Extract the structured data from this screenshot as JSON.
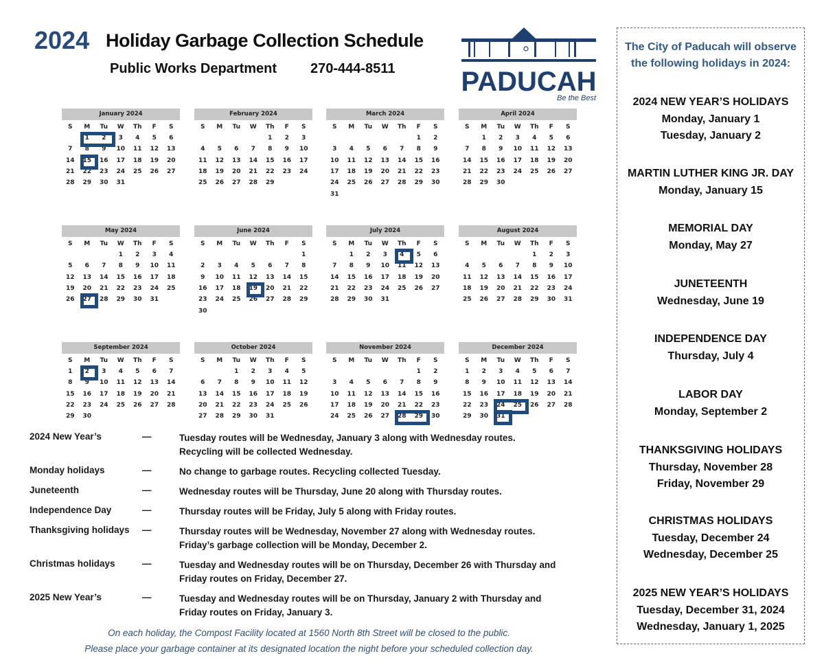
{
  "header": {
    "year": "2024",
    "title": "Holiday Garbage Collection Schedule",
    "department": "Public Works Department",
    "phone": "270-444-8511"
  },
  "logo": {
    "name": "PADUCAH",
    "tagline": "Be the Best",
    "color": "#1f3f6e"
  },
  "weekdays": [
    "S",
    "M",
    "Tu",
    "W",
    "Th",
    "F",
    "S"
  ],
  "accent": "#1f4a7d",
  "months": [
    {
      "title": "January 2024",
      "start": 1,
      "days": 31,
      "highlights": [
        [
          1,
          2
        ],
        [
          15
        ]
      ]
    },
    {
      "title": "February 2024",
      "start": 4,
      "days": 29,
      "highlights": []
    },
    {
      "title": "March 2024",
      "start": 5,
      "days": 31,
      "highlights": []
    },
    {
      "title": "April 2024",
      "start": 1,
      "days": 30,
      "highlights": []
    },
    {
      "title": "May 2024",
      "start": 3,
      "days": 31,
      "highlights": [
        [
          27
        ]
      ]
    },
    {
      "title": "June 2024",
      "start": 6,
      "days": 30,
      "highlights": [
        [
          19
        ]
      ]
    },
    {
      "title": "July 2024",
      "start": 1,
      "days": 31,
      "highlights": [
        [
          4
        ]
      ]
    },
    {
      "title": "August 2024",
      "start": 4,
      "days": 31,
      "highlights": []
    },
    {
      "title": "September 2024",
      "start": 0,
      "days": 30,
      "highlights": [
        [
          2
        ]
      ]
    },
    {
      "title": "October 2024",
      "start": 2,
      "days": 31,
      "highlights": []
    },
    {
      "title": "November 2024",
      "start": 5,
      "days": 30,
      "highlights": [
        [
          28,
          29
        ]
      ]
    },
    {
      "title": "December 2024",
      "start": 0,
      "days": 31,
      "highlights": [
        [
          24,
          25
        ],
        [
          31
        ]
      ]
    }
  ],
  "notes": [
    {
      "label": "2024 New Year’s",
      "dash": "—",
      "lines": [
        "Tuesday routes will be Wednesday, January 3  along with Wednesday routes.",
        "Recycling will be collected Wednesday."
      ]
    },
    {
      "label": "Monday holidays",
      "dash": "—",
      "lines": [
        "No change to garbage routes. Recycling collected Tuesday."
      ]
    },
    {
      "label": "Juneteenth",
      "dash": "—",
      "lines": [
        "Wednesday routes will be Thursday, June 20 along with Thursday routes."
      ]
    },
    {
      "label": "Independence Day",
      "dash": "—",
      "lines": [
        "Thursday routes will be Friday, July 5 along with Friday routes."
      ]
    },
    {
      "label": "Thanksgiving holidays",
      "dash": "—",
      "lines": [
        "Thursday routes will be Wednesday, November 27 along with Wednesday routes.",
        "Friday’s garbage collection will be Monday, December 2."
      ]
    },
    {
      "label": "Christmas holidays",
      "dash": "—",
      "lines": [
        "Tuesday and Wednesday routes will be on Thursday, December 26 with Thursday and",
        "Friday routes on Friday, December 27."
      ]
    },
    {
      "label": "2025 New Year’s",
      "dash": "—",
      "lines": [
        "Tuesday and Wednesday routes will be on Thursday, January 2 with Thursday and",
        "Friday routes on Friday, January 3."
      ]
    }
  ],
  "footer": [
    "On each holiday, the Compost Facility located at 1560 North 8th Street will be closed to the public.",
    "Please place your garbage container at its designated location the night before your scheduled collection day."
  ],
  "sidebar": {
    "title_lines": [
      "The City of Paducah will observe",
      "the following holidays in 2024:"
    ],
    "holidays": [
      {
        "name": "2024 NEW YEAR’S HOLIDAYS",
        "dates": [
          "Monday, January 1",
          "Tuesday, January 2"
        ]
      },
      {
        "name": "MARTIN LUTHER KING JR. DAY",
        "dates": [
          "Monday, January 15"
        ]
      },
      {
        "name": "MEMORIAL DAY",
        "dates": [
          "Monday, May 27"
        ]
      },
      {
        "name": "JUNETEENTH",
        "dates": [
          "Wednesday, June 19"
        ]
      },
      {
        "name": "INDEPENDENCE DAY",
        "dates": [
          "Thursday, July 4"
        ]
      },
      {
        "name": "LABOR DAY",
        "dates": [
          "Monday, September 2"
        ]
      },
      {
        "name": "THANKSGIVING  HOLIDAYS",
        "dates": [
          "Thursday, November 28",
          "Friday, November 29"
        ]
      },
      {
        "name": "CHRISTMAS HOLIDAYS",
        "dates": [
          "Tuesday, December 24",
          "Wednesday, December 25"
        ]
      },
      {
        "name": "2025 NEW YEAR’S HOLIDAYS",
        "dates": [
          "Tuesday, December 31, 2024",
          "Wednesday, January 1, 2025"
        ]
      }
    ]
  }
}
